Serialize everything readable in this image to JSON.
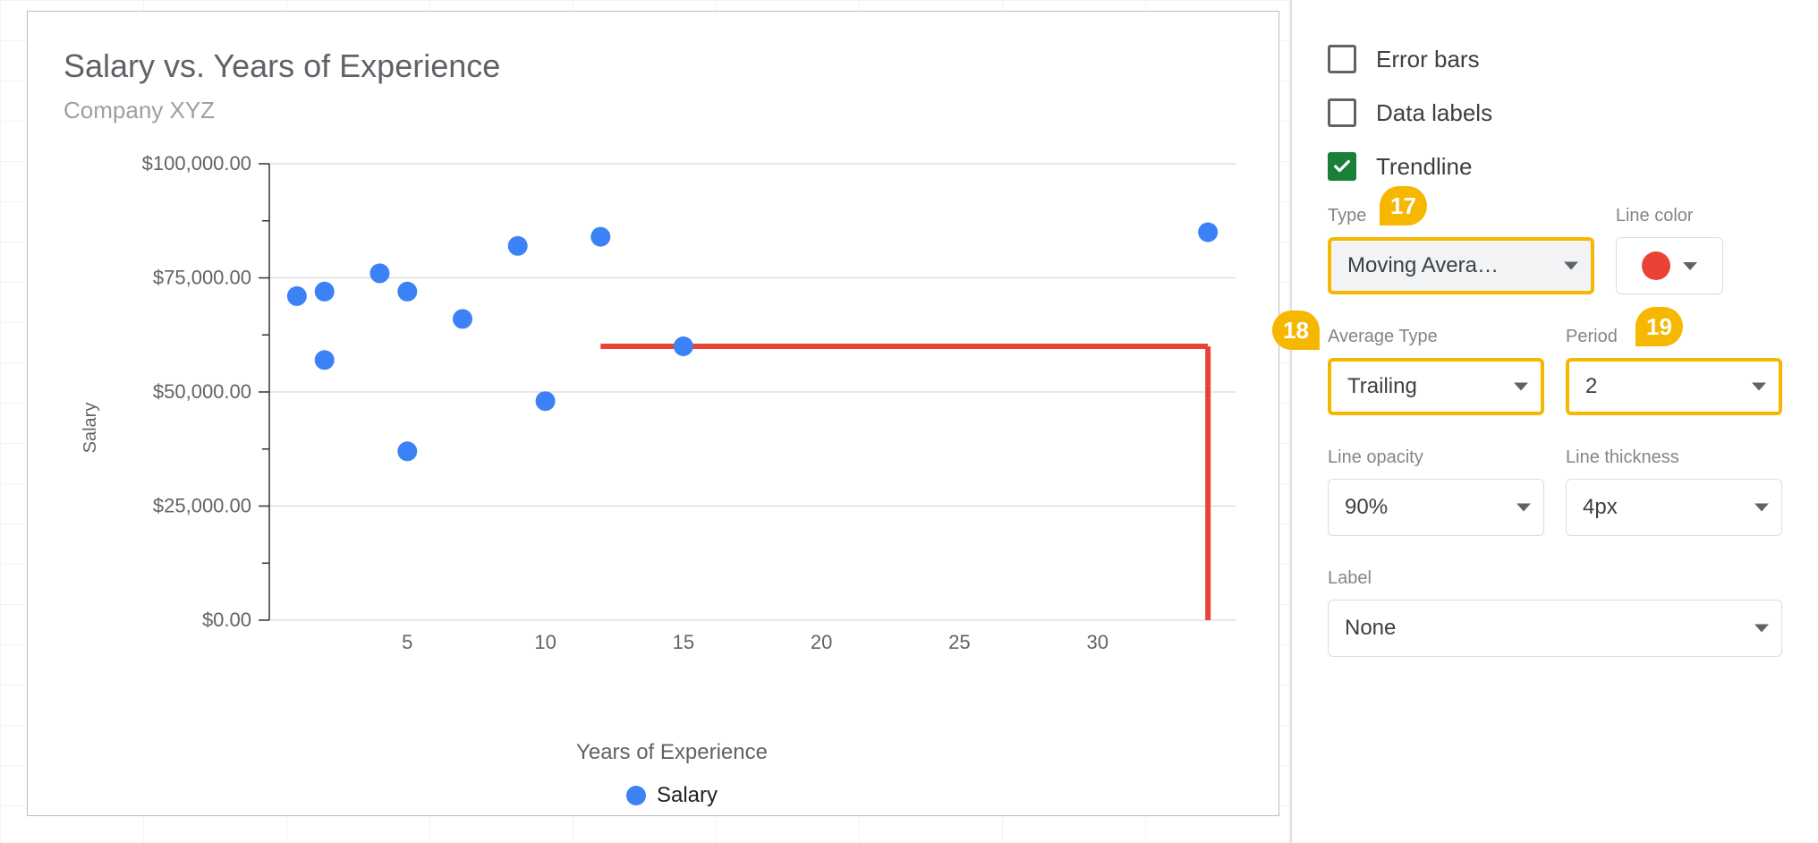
{
  "chart_data": {
    "type": "scatter",
    "title": "Salary vs. Years of Experience",
    "subtitle": "Company XYZ",
    "xlabel": "Years of Experience",
    "ylabel": "Salary",
    "xlim": [
      0,
      35
    ],
    "ylim": [
      0,
      100000
    ],
    "x_ticks": [
      5,
      10,
      15,
      20,
      25,
      30
    ],
    "y_ticks": [
      "$0.00",
      "$25,000.00",
      "$50,000.00",
      "$75,000.00",
      "$100,000.00"
    ],
    "y_tick_values": [
      0,
      25000,
      50000,
      75000,
      100000
    ],
    "series": [
      {
        "name": "Salary",
        "color": "#3b82f6",
        "points": [
          {
            "x": 1,
            "y": 71000
          },
          {
            "x": 2,
            "y": 72000
          },
          {
            "x": 2,
            "y": 57000
          },
          {
            "x": 4,
            "y": 76000
          },
          {
            "x": 5,
            "y": 72000
          },
          {
            "x": 5,
            "y": 37000
          },
          {
            "x": 7,
            "y": 66000
          },
          {
            "x": 9,
            "y": 82000
          },
          {
            "x": 10,
            "y": 48000
          },
          {
            "x": 12,
            "y": 84000
          },
          {
            "x": 15,
            "y": 60000
          },
          {
            "x": 34,
            "y": 85000
          }
        ]
      }
    ],
    "trendline": {
      "type": "moving_average",
      "color": "#ea4335",
      "segments": [
        {
          "x1": 12,
          "y1": 60000,
          "x2": 34,
          "y2": 60000
        },
        {
          "x1": 34,
          "y1": 60000,
          "x2": 34,
          "y2": 0
        }
      ]
    },
    "legend": [
      "Salary"
    ]
  },
  "sidebar": {
    "error_bars_label": "Error bars",
    "error_bars_checked": false,
    "data_labels_label": "Data labels",
    "data_labels_checked": false,
    "trendline_label": "Trendline",
    "trendline_checked": true,
    "type_label": "Type",
    "type_value": "Moving Avera…",
    "line_color_label": "Line color",
    "line_color_value": "#ea4335",
    "average_type_label": "Average Type",
    "average_type_value": "Trailing",
    "period_label": "Period",
    "period_value": "2",
    "line_opacity_label": "Line opacity",
    "line_opacity_value": "90%",
    "line_thickness_label": "Line thickness",
    "line_thickness_value": "4px",
    "label_label": "Label",
    "label_value": "None"
  },
  "annotations": {
    "b17": "17",
    "b18": "18",
    "b19": "19"
  }
}
